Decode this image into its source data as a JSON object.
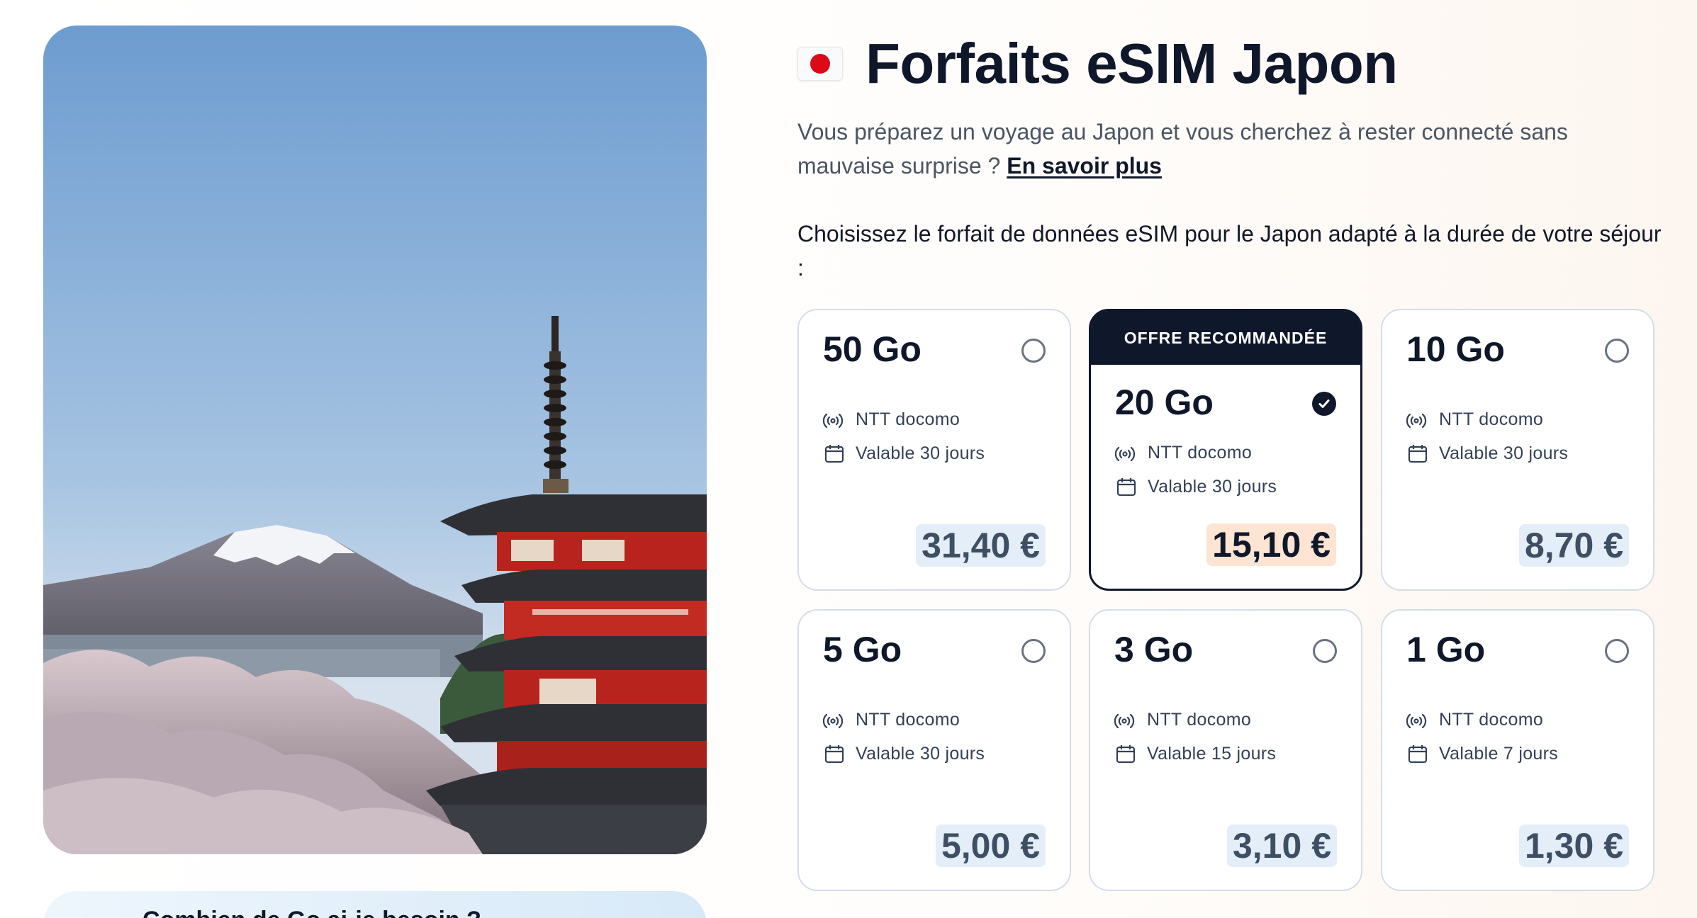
{
  "page": {
    "title": "Forfaits eSIM Japon",
    "intro_text": "Vous préparez un voyage au Japon et vous cherchez à rester connecté sans mauvaise surprise ?",
    "intro_link": "En savoir plus",
    "choose_text": "Choisissez le forfait de données eSIM pour le Japon adapté à la durée de votre séjour :",
    "info_box_text": "Combien de Go ai-je besoin ?"
  },
  "colors": {
    "primary": "#0f172a",
    "price_bg": "#e3eef8",
    "price_bg_selected": "#fde4d3",
    "flag_red": "#dc0a16"
  },
  "plans": [
    {
      "size": "50 Go",
      "operator": "NTT docomo",
      "validity": "Valable 30 jours",
      "price": "31,40 €",
      "selected": false
    },
    {
      "size": "20 Go",
      "operator": "NTT docomo",
      "validity": "Valable 30 jours",
      "price": "15,10 €",
      "selected": true,
      "badge": "OFFRE RECOMMANDÉE"
    },
    {
      "size": "10 Go",
      "operator": "NTT docomo",
      "validity": "Valable 30 jours",
      "price": "8,70 €",
      "selected": false
    },
    {
      "size": "5 Go",
      "operator": "NTT docomo",
      "validity": "Valable 30 jours",
      "price": "5,00 €",
      "selected": false
    },
    {
      "size": "3 Go",
      "operator": "NTT docomo",
      "validity": "Valable 15 jours",
      "price": "3,10 €",
      "selected": false
    },
    {
      "size": "1 Go",
      "operator": "NTT docomo",
      "validity": "Valable 7 jours",
      "price": "1,30 €",
      "selected": false
    }
  ],
  "icons": {
    "flag": "japan-flag-icon",
    "operator": "signal-icon",
    "validity": "calendar-icon",
    "selected": "check-circle-icon"
  }
}
